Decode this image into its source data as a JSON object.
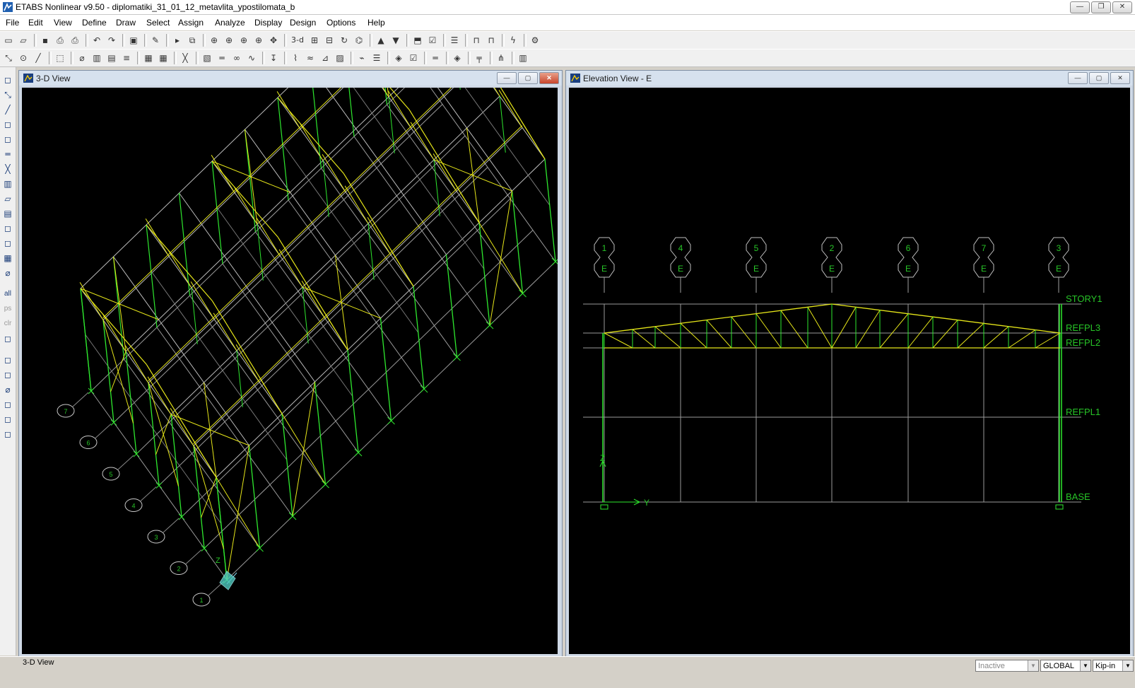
{
  "app": {
    "title": "ETABS Nonlinear v9.50 - diplomatiki_31_01_12_metavlita_ypostilomata_b"
  },
  "menu": {
    "items": [
      "File",
      "Edit",
      "View",
      "Define",
      "Draw",
      "Select",
      "Assign",
      "Analyze",
      "Display",
      "Design",
      "Options",
      "Help"
    ]
  },
  "toolbar1": {
    "icons": [
      "new-model-icon",
      "open-icon",
      "sep",
      "save-icon",
      "print-icon",
      "print-dropdown-icon",
      "sep",
      "undo-icon",
      "redo-icon",
      "sep",
      "lock-icon",
      "sep",
      "pencil-icon",
      "sep",
      "run-icon",
      "properties-icon",
      "sep",
      "zoom-window-icon",
      "zoom-restore-icon",
      "zoom-in-icon",
      "zoom-out-icon",
      "pan-icon",
      "sep",
      "3d-view-label",
      "plan-view-icon",
      "elevation-view-icon",
      "rotate-icon",
      "perspective-icon",
      "sep",
      "move-up-icon",
      "move-down-icon",
      "sep",
      "object-shrink-icon",
      "check-icon",
      "sep",
      "set-display-icon",
      "sep",
      "frame-icon",
      "frame-dropdown-icon",
      "sep",
      "lightning-icon",
      "sep",
      "options-icon"
    ],
    "three_d_label": "3-d"
  },
  "toolbar2": {
    "icons": [
      "reshape-icon",
      "draw-point-icon",
      "draw-line-icon",
      "sep",
      "select-dropdown-icon",
      "sep",
      "section-cut-icon",
      "wall-icon",
      "slab-icon",
      "rebar-icon",
      "sep",
      "grid-icon",
      "grid2-icon",
      "sep",
      "brace-icon",
      "sep",
      "deck-icon",
      "beam-icon",
      "link-icon",
      "spring-icon",
      "sep",
      "load-icon",
      "sep",
      "deformed-shape-icon",
      "mode-shape-icon",
      "force-diagram-icon",
      "stress-icon",
      "sep",
      "response-icon",
      "display-table-icon",
      "sep",
      "design-icon",
      "check-help-icon",
      "sep",
      "i-beam-icon",
      "sep",
      "steel-design-icon",
      "sep",
      "composite-icon",
      "sep",
      "joist-icon",
      "sep",
      "shear-wall-icon"
    ]
  },
  "left_toolbar": {
    "icons": [
      "pointer-icon",
      "reshape-icon",
      "draw-line-icon",
      "draw-area-icon",
      "column-icon",
      "beam-icon",
      "brace-icon",
      "wall-icon",
      "opening-icon",
      "slab-icon",
      "null-line-icon",
      "line-icon",
      "grid-area-icon",
      "section-cut-icon",
      "select-all-label",
      "prev-select-label",
      "clear-select-label",
      "invert-icon",
      "snap-joint-icon",
      "snap-midpoint-icon",
      "snap-intersection-icon",
      "snap-perp-icon",
      "snap-line-icon",
      "snap-fine-icon"
    ],
    "labels": {
      "all": "all",
      "ps": "ps",
      "clr": "clr"
    }
  },
  "view_3d": {
    "title": "3-D View",
    "axis_label": "Z",
    "grid_bubbles": [
      "1",
      "2",
      "3",
      "4",
      "5",
      "6",
      "7"
    ]
  },
  "view_elevation": {
    "title": "Elevation View - E",
    "grid_labels_top": [
      "1",
      "4",
      "5",
      "2",
      "6",
      "7",
      "3"
    ],
    "grid_labels_bottom": [
      "E",
      "E",
      "E",
      "E",
      "E",
      "E",
      "E"
    ],
    "story_labels": [
      "STORY1",
      "REFPL3",
      "REFPL2",
      "REFPL1",
      "BASE"
    ],
    "axis_z": "Z",
    "axis_y": "Y"
  },
  "colors": {
    "background": "#000000",
    "truss": "#e6e619",
    "column": "#2ee82e",
    "grid": "#9a9a9a",
    "label": "#27c427"
  },
  "status": {
    "text": "3-D View",
    "mode": "Inactive",
    "coord_system": "GLOBAL",
    "units": "Kip-in"
  }
}
